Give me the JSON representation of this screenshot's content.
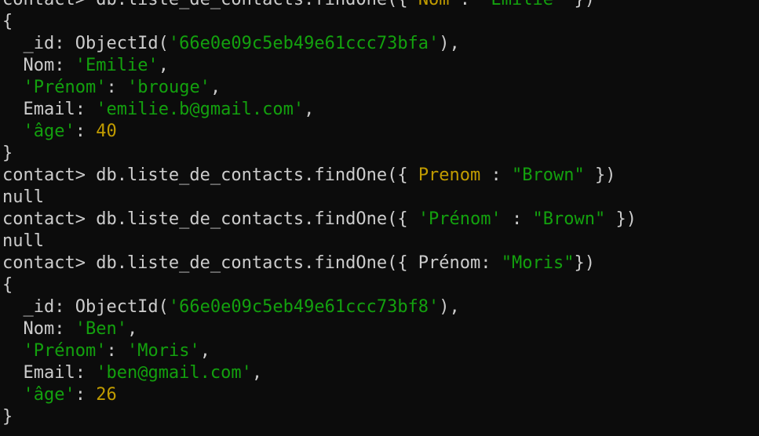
{
  "colors": {
    "background": "#0c0c0c",
    "plain": "#cccccc",
    "key": "#c19c00",
    "string": "#13a10e",
    "number": "#c19c00"
  },
  "lines": [
    [
      {
        "t": "contact> db.liste_de_contacts.findOne({ ",
        "c": "plain"
      },
      {
        "t": "Nom",
        "c": "key"
      },
      {
        "t": " : ",
        "c": "plain"
      },
      {
        "t": "\"Emilie\"",
        "c": "string"
      },
      {
        "t": " })",
        "c": "plain"
      }
    ],
    [
      {
        "t": "{",
        "c": "plain"
      }
    ],
    [
      {
        "t": "  _id: ObjectId(",
        "c": "plain"
      },
      {
        "t": "'66e0e09c5eb49e61ccc73bfa'",
        "c": "string"
      },
      {
        "t": "),",
        "c": "plain"
      }
    ],
    [
      {
        "t": "  Nom: ",
        "c": "plain"
      },
      {
        "t": "'Emilie'",
        "c": "string"
      },
      {
        "t": ",",
        "c": "plain"
      }
    ],
    [
      {
        "t": "  ",
        "c": "plain"
      },
      {
        "t": "'Prénom'",
        "c": "string"
      },
      {
        "t": ": ",
        "c": "plain"
      },
      {
        "t": "'brouge'",
        "c": "string"
      },
      {
        "t": ",",
        "c": "plain"
      }
    ],
    [
      {
        "t": "  Email: ",
        "c": "plain"
      },
      {
        "t": "'emilie.b@gmail.com'",
        "c": "string"
      },
      {
        "t": ",",
        "c": "plain"
      }
    ],
    [
      {
        "t": "  ",
        "c": "plain"
      },
      {
        "t": "'âge'",
        "c": "string"
      },
      {
        "t": ": ",
        "c": "plain"
      },
      {
        "t": "40",
        "c": "number"
      }
    ],
    [
      {
        "t": "}",
        "c": "plain"
      }
    ],
    [
      {
        "t": "contact> db.liste_de_contacts.findOne({ ",
        "c": "plain"
      },
      {
        "t": "Prenom",
        "c": "key"
      },
      {
        "t": " : ",
        "c": "plain"
      },
      {
        "t": "\"Brown\"",
        "c": "string"
      },
      {
        "t": " })",
        "c": "plain"
      }
    ],
    [
      {
        "t": "null",
        "c": "plain"
      }
    ],
    [
      {
        "t": "contact> db.liste_de_contacts.findOne({ ",
        "c": "plain"
      },
      {
        "t": "'Prénom'",
        "c": "string"
      },
      {
        "t": " : ",
        "c": "plain"
      },
      {
        "t": "\"Brown\"",
        "c": "string"
      },
      {
        "t": " })",
        "c": "plain"
      }
    ],
    [
      {
        "t": "null",
        "c": "plain"
      }
    ],
    [
      {
        "t": "contact> db.liste_de_contacts.findOne({ Prénom: ",
        "c": "plain"
      },
      {
        "t": "\"Moris\"",
        "c": "string"
      },
      {
        "t": "})",
        "c": "plain"
      }
    ],
    [
      {
        "t": "{",
        "c": "plain"
      }
    ],
    [
      {
        "t": "  _id: ObjectId(",
        "c": "plain"
      },
      {
        "t": "'66e0e09c5eb49e61ccc73bf8'",
        "c": "string"
      },
      {
        "t": "),",
        "c": "plain"
      }
    ],
    [
      {
        "t": "  Nom: ",
        "c": "plain"
      },
      {
        "t": "'Ben'",
        "c": "string"
      },
      {
        "t": ",",
        "c": "plain"
      }
    ],
    [
      {
        "t": "  ",
        "c": "plain"
      },
      {
        "t": "'Prénom'",
        "c": "string"
      },
      {
        "t": ": ",
        "c": "plain"
      },
      {
        "t": "'Moris'",
        "c": "string"
      },
      {
        "t": ",",
        "c": "plain"
      }
    ],
    [
      {
        "t": "  Email: ",
        "c": "plain"
      },
      {
        "t": "'ben@gmail.com'",
        "c": "string"
      },
      {
        "t": ",",
        "c": "plain"
      }
    ],
    [
      {
        "t": "  ",
        "c": "plain"
      },
      {
        "t": "'âge'",
        "c": "string"
      },
      {
        "t": ": ",
        "c": "plain"
      },
      {
        "t": "26",
        "c": "number"
      }
    ],
    [
      {
        "t": "}",
        "c": "plain"
      }
    ]
  ]
}
